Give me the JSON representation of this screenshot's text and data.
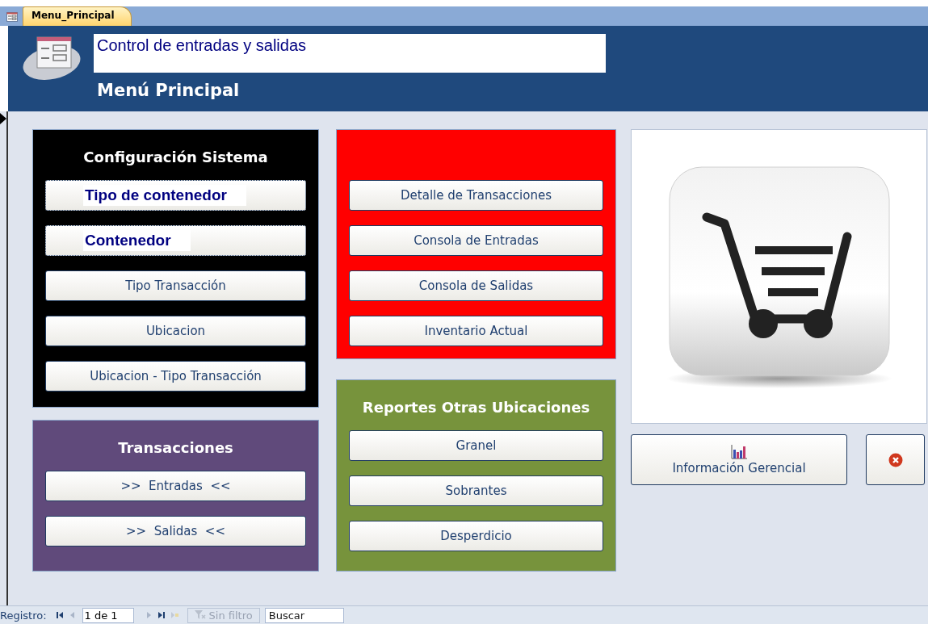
{
  "tab": {
    "label": "Menu_Principal",
    "selected": true
  },
  "header": {
    "title": "Control de entradas y salidas",
    "subtitle": "Menú Principal"
  },
  "columns": [
    {
      "panels": [
        {
          "title": "Configuración Sistema",
          "color": "#000000",
          "buttons": [
            {
              "label": "Tipo de contenedor",
              "kind": "highlight"
            },
            {
              "label": "Contenedor",
              "kind": "highlight"
            },
            {
              "label": "Tipo Transacción",
              "kind": "plain"
            },
            {
              "label": "Ubicacion",
              "kind": "plain"
            },
            {
              "label": "Ubicacion - Tipo Transacción",
              "kind": "plain"
            }
          ]
        },
        {
          "title": "Transacciones",
          "color": "#604a7b",
          "buttons": [
            {
              "label": ">>  Entradas  <<",
              "kind": "plain"
            },
            {
              "label": ">>  Salidas  <<",
              "kind": "plain"
            }
          ]
        }
      ]
    },
    {
      "panels": [
        {
          "color": "#ff0000",
          "buttons": [
            {
              "label": "Detalle de Transacciones",
              "kind": "plain"
            },
            {
              "label": "Consola de Entradas",
              "kind": "plain"
            },
            {
              "label": "Consola de Salidas",
              "kind": "plain"
            },
            {
              "label": "Inventario Actual",
              "kind": "plain"
            }
          ]
        },
        {
          "title": "Reportes Otras Ubicaciones",
          "color": "#77933c",
          "buttons": [
            {
              "label": "Granel",
              "kind": "plain"
            },
            {
              "label": "Sobrantes",
              "kind": "plain"
            },
            {
              "label": "Desperdicio",
              "kind": "plain"
            }
          ]
        }
      ]
    }
  ],
  "side_buttons": [
    {
      "label": "Información Gerencial",
      "kind": "chart"
    },
    {
      "kind": "close"
    }
  ],
  "status_bar": {
    "label": "Registro:",
    "position": "1 de 1",
    "filter": "Sin filtro",
    "search_placeholder": "Buscar"
  }
}
